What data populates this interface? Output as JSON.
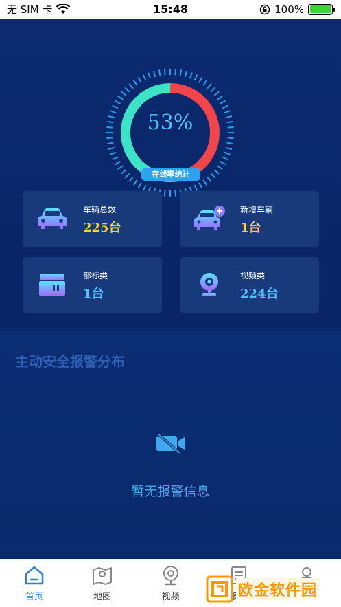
{
  "status_bar": {
    "carrier": "无 SIM 卡",
    "time": "15:48",
    "battery": "100%"
  },
  "gauge": {
    "percent_text": "53%",
    "online_fraction": 0.53,
    "online_color": "#3de3c6",
    "offline_color": "#f0454a",
    "label": "在线率统计"
  },
  "cards": [
    {
      "label": "车辆总数",
      "value": "225台",
      "value_color": "#ffd03a",
      "icon": "car-icon"
    },
    {
      "label": "新增车辆",
      "value": "1台",
      "value_color": "#ffd03a",
      "icon": "car-add-icon"
    },
    {
      "label": "部标类",
      "value": "1台",
      "value_color": "#4dc4ff",
      "icon": "device-box-icon"
    },
    {
      "label": "视频类",
      "value": "224台",
      "value_color": "#4dc4ff",
      "icon": "webcam-icon"
    }
  ],
  "alarm": {
    "title": "主动安全报警分布",
    "empty_text": "暂无报警信息"
  },
  "tabs": [
    {
      "label": "首页",
      "icon": "home-icon",
      "active": true
    },
    {
      "label": "地图",
      "icon": "map-icon",
      "active": false
    },
    {
      "label": "视频",
      "icon": "camera-icon",
      "active": false
    },
    {
      "label": "报表",
      "icon": "report-icon",
      "active": false
    },
    {
      "label": "我的",
      "icon": "user-icon",
      "active": false
    }
  ],
  "watermark": {
    "text": "欧金软件园"
  }
}
